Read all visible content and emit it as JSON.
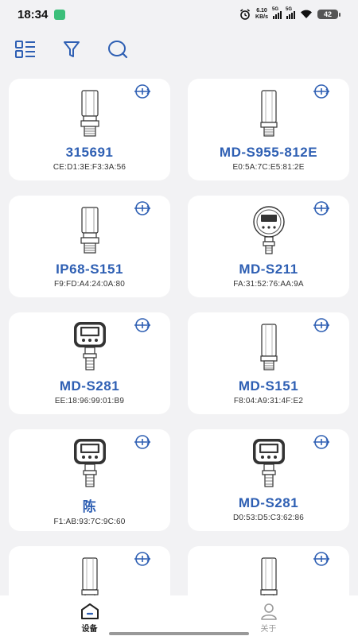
{
  "status_bar": {
    "time": "18:34",
    "net_speed_value": "6.10",
    "net_speed_unit": "KB/s",
    "signal_1_label": "5G",
    "signal_2_label": "5G",
    "battery": "42"
  },
  "toolbar": {
    "icons": [
      "list-view-icon",
      "filter-icon",
      "search-icon"
    ]
  },
  "devices": [
    {
      "name": "315691",
      "mac": "CE:D1:3E:F3:3A:56",
      "image": "cylinder-sensor"
    },
    {
      "name": "MD-S955-812E",
      "mac": "E0:5A:7C:E5:81:2E",
      "image": "tall-cylinder-sensor"
    },
    {
      "name": "IP68-S151",
      "mac": "F9:FD:A4:24:0A:80",
      "image": "cylinder-sensor"
    },
    {
      "name": "MD-S211",
      "mac": "FA:31:52:76:AA:9A",
      "image": "round-gauge"
    },
    {
      "name": "MD-S281",
      "mac": "EE:18:96:99:01:B9",
      "image": "digital-gauge"
    },
    {
      "name": "MD-S151",
      "mac": "F8:04:A9:31:4F:E2",
      "image": "tall-cylinder-sensor"
    },
    {
      "name": "陈",
      "mac": "F1:AB:93:7C:9C:60",
      "image": "digital-gauge"
    },
    {
      "name": "MD-S281",
      "mac": "D0:53:D5:C3:62:86",
      "image": "digital-gauge"
    },
    {
      "name": "",
      "mac": "",
      "image": "tall-cylinder-sensor"
    },
    {
      "name": "",
      "mac": "",
      "image": "tall-cylinder-sensor"
    }
  ],
  "colors": {
    "accent": "#2e5fb3",
    "background": "#f2f2f4",
    "card": "#ffffff"
  },
  "bottom_nav": {
    "devices_label": "设备",
    "about_label": "关于"
  }
}
